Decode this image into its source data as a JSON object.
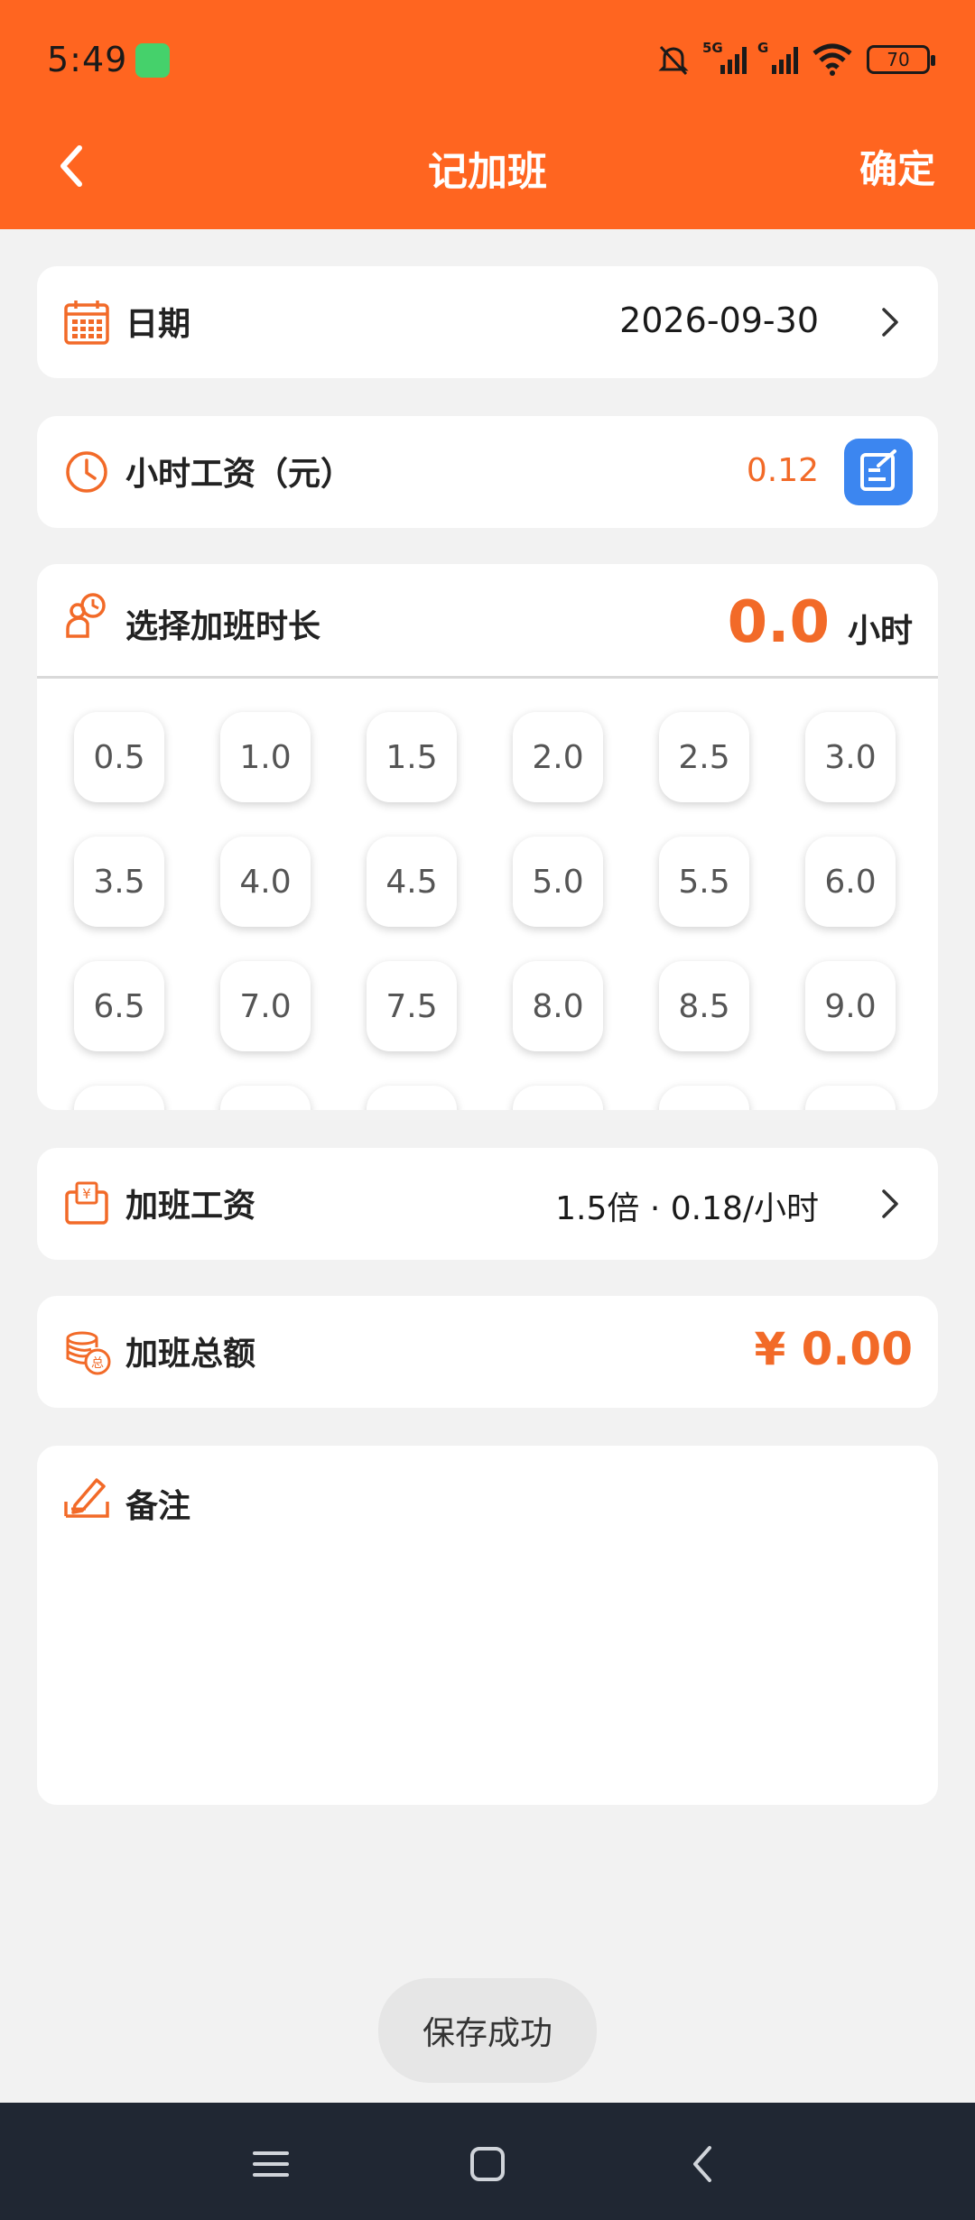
{
  "status": {
    "time": "5:49",
    "battery": "70",
    "net1": "5G",
    "net2": "G"
  },
  "header": {
    "title": "记加班",
    "confirm": "确定"
  },
  "date": {
    "label": "日期",
    "value": "2026-09-30"
  },
  "hourly_wage": {
    "label": "小时工资（元）",
    "value": "0.12"
  },
  "duration": {
    "label": "选择加班时长",
    "value": "0.0",
    "unit": "小时",
    "options": [
      "0.5",
      "1.0",
      "1.5",
      "2.0",
      "2.5",
      "3.0",
      "3.5",
      "4.0",
      "4.5",
      "5.0",
      "5.5",
      "6.0",
      "6.5",
      "7.0",
      "7.5",
      "8.0",
      "8.5",
      "9.0",
      "",
      "",
      "",
      "",
      "",
      ""
    ]
  },
  "overtime_pay": {
    "label": "加班工资",
    "value": "1.5倍 · 0.18/小时"
  },
  "total": {
    "label": "加班总额",
    "value": "¥ 0.00"
  },
  "note": {
    "label": "备注",
    "value": ""
  },
  "toast": "保存成功",
  "colors": {
    "accent": "#ff6520",
    "highlight": "#f26a28",
    "edit_button": "#3c86f0",
    "navbar": "#202733"
  }
}
